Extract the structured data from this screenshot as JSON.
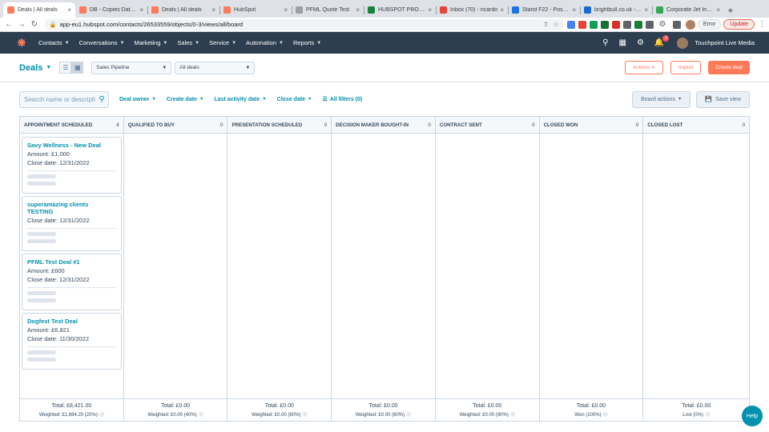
{
  "browser": {
    "tabs": [
      {
        "label": "Deals | All deals",
        "favicon_color": "#ff7a59",
        "active": true
      },
      {
        "label": "DB - Copies Database",
        "favicon_color": "#ff7a59",
        "active": false
      },
      {
        "label": "Deals | All deals",
        "favicon_color": "#ff7a59",
        "active": false
      },
      {
        "label": "HubSpot",
        "favicon_color": "#ff7a59",
        "active": false
      },
      {
        "label": "PFML Quote Test",
        "favicon_color": "#9aa0a6",
        "active": false
      },
      {
        "label": "HUBSPOT PRODUCTS",
        "favicon_color": "#188038",
        "active": false
      },
      {
        "label": "Inbox (70) - ricardo",
        "favicon_color": "#ea4335",
        "active": false
      },
      {
        "label": "Stand F22 - Postcode",
        "favicon_color": "#1a73e8",
        "active": false
      },
      {
        "label": "brightbull.co.uk - Co",
        "favicon_color": "#1967d2",
        "active": false
      },
      {
        "label": "Corporate Jet Invest",
        "favicon_color": "#34a853",
        "active": false
      }
    ],
    "close_glyph": "×",
    "new_tab_glyph": "+",
    "url": "app-eu1.hubspot.com/contacts/26533559/objects/0-3/views/all/board",
    "extension_colors": [
      "#4285f4",
      "#ea4335",
      "#0f9d58",
      "#137333",
      "#d93025",
      "#5f6368",
      "#188038",
      "#5f6368"
    ],
    "error_label": "Error",
    "update_label": "Update"
  },
  "hubspot_nav": {
    "logo": "hubspot-sprocket",
    "items": [
      {
        "label": "Contacts"
      },
      {
        "label": "Conversations"
      },
      {
        "label": "Marketing"
      },
      {
        "label": "Sales"
      },
      {
        "label": "Service"
      },
      {
        "label": "Automation"
      },
      {
        "label": "Reports"
      }
    ],
    "notification_count": "3",
    "account_name": "Touchpoint Live Media"
  },
  "header": {
    "object_title": "Deals",
    "pipeline_select": "Sales Pipeline",
    "view_select": "All deals",
    "actions_label": "Actions",
    "import_label": "Import",
    "create_label": "Create deal"
  },
  "filters": {
    "search_placeholder": "Search name or description",
    "deal_owner": "Deal owner",
    "create_date": "Create date",
    "last_activity_date": "Last activity date",
    "close_date": "Close date",
    "all_filters": "All filters (0)",
    "board_actions": "Board actions",
    "save_view": "Save view"
  },
  "board": {
    "columns": [
      {
        "name": "APPOINTMENT SCHEDULED",
        "count": "4",
        "total": "Total: £8,421.00",
        "weighted": "Weighted: £1,684.20 (20%)",
        "cards": [
          {
            "name": "Savy Wellness - New Deal",
            "amount": "Amount: £1,000",
            "close": "Close date: 12/31/2022"
          },
          {
            "name": "superamazing clients TESTING",
            "amount": "",
            "close": "Close date: 12/31/2022"
          },
          {
            "name": "PFML Test Deal #1",
            "amount": "Amount: £600",
            "close": "Close date: 12/31/2022"
          },
          {
            "name": "Dogfest Test Deal",
            "amount": "Amount: £6,821",
            "close": "Close date: 11/30/2022"
          }
        ]
      },
      {
        "name": "QUALIFIED TO BUY",
        "count": "0",
        "total": "Total: £0.00",
        "weighted": "Weighted: £0.00 (40%)",
        "cards": []
      },
      {
        "name": "PRESENTATION SCHEDULED",
        "count": "0",
        "total": "Total: £0.00",
        "weighted": "Weighted: £0.00 (60%)",
        "cards": []
      },
      {
        "name": "DECISION MAKER BOUGHT-IN",
        "count": "0",
        "total": "Total: £0.00",
        "weighted": "Weighted: £0.00 (80%)",
        "cards": []
      },
      {
        "name": "CONTRACT SENT",
        "count": "0",
        "total": "Total: £0.00",
        "weighted": "Weighted: £0.00 (90%)",
        "cards": []
      },
      {
        "name": "CLOSED WON",
        "count": "0",
        "total": "Total: £0.00",
        "weighted": "Won (100%)",
        "cards": []
      },
      {
        "name": "CLOSED LOST",
        "count": "0",
        "total": "Total: £0.00",
        "weighted": "Lost (0%)",
        "cards": []
      }
    ]
  },
  "help_label": "Help",
  "colors": {
    "nav_bg": "#2d3e50",
    "accent_orange": "#ff7a59",
    "link_teal": "#0091ae",
    "border": "#cbd6e2"
  }
}
